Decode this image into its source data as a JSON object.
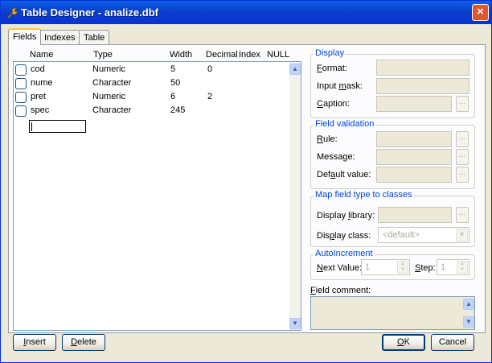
{
  "window": {
    "title": "Table Designer - analize.dbf",
    "close_glyph": "×",
    "icon": "tool-wrench-icon"
  },
  "tabs": [
    {
      "label": "Fields",
      "active": true
    },
    {
      "label": "Indexes",
      "active": false
    },
    {
      "label": "Table",
      "active": false
    }
  ],
  "grid": {
    "columns": [
      "Name",
      "Type",
      "Width",
      "Decimal",
      "Index",
      "NULL"
    ],
    "rows": [
      {
        "name": "cod",
        "type": "Numeric",
        "width": "5",
        "decimal": "0"
      },
      {
        "name": "nume",
        "type": "Character",
        "width": "50",
        "decimal": ""
      },
      {
        "name": "pret",
        "type": "Numeric",
        "width": "6",
        "decimal": "2"
      },
      {
        "name": "spec",
        "type": "Character",
        "width": "245",
        "decimal": ""
      }
    ],
    "new_row_name": ""
  },
  "display": {
    "legend": "Display",
    "format": {
      "pre": "",
      "key": "F",
      "post": "ormat:",
      "value": ""
    },
    "input_mask": {
      "pre": "Input ",
      "key": "m",
      "post": "ask:",
      "value": ""
    },
    "caption": {
      "pre": "",
      "key": "C",
      "post": "aption:",
      "value": ""
    }
  },
  "validation": {
    "legend": "Field validation",
    "rule": {
      "pre": "",
      "key": "R",
      "post": "ule:",
      "value": ""
    },
    "message": {
      "label": "Message:",
      "value": ""
    },
    "default_value": {
      "pre": "Def",
      "key": "a",
      "post": "ult value:",
      "value": ""
    }
  },
  "map_classes": {
    "legend": "Map field type to classes",
    "library": {
      "pre": "Display ",
      "key": "l",
      "post": "ibrary:",
      "value": ""
    },
    "class": {
      "pre": "Dis",
      "key": "p",
      "post": "lay class:",
      "value": "<default>"
    }
  },
  "autoincrement": {
    "legend": "AutoIncrement",
    "next_value": {
      "pre": "",
      "key": "N",
      "post": "ext Value:",
      "value": "1"
    },
    "step": {
      "pre": "",
      "key": "S",
      "post": "tep:",
      "value": "1"
    }
  },
  "comment": {
    "pre": "",
    "key": "F",
    "post": "ield comment:",
    "value": ""
  },
  "buttons": {
    "ellipsis": "...",
    "insert": {
      "pre": "",
      "key": "I",
      "post": "nsert"
    },
    "delete": {
      "pre": "",
      "key": "D",
      "post": "elete"
    },
    "ok": {
      "pre": "",
      "key": "O",
      "post": "K"
    },
    "cancel": {
      "label": "Cancel"
    }
  },
  "scroll": {
    "up": "▲",
    "down": "▼"
  }
}
